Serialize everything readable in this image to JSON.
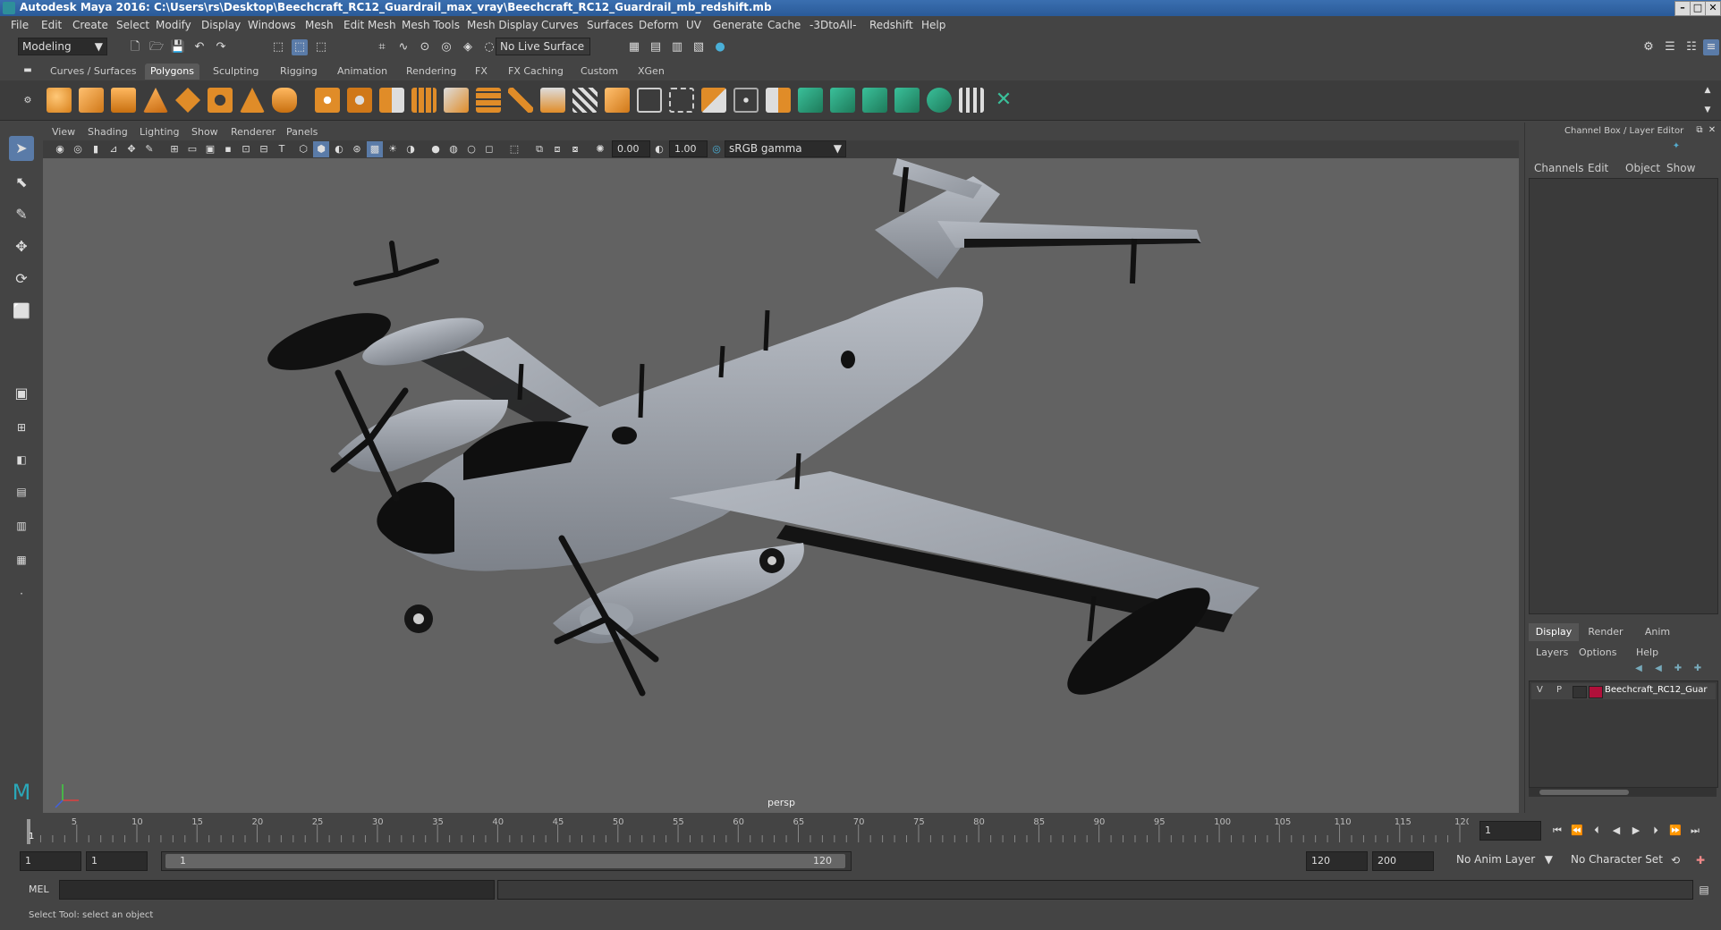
{
  "window": {
    "title": "Autodesk Maya 2016: C:\\Users\\rs\\Desktop\\Beechcraft_RC12_Guardrail_max_vray\\Beechcraft_RC12_Guardrail_mb_redshift.mb",
    "min": "–",
    "max": "□",
    "close": "✕"
  },
  "menubar": [
    "File",
    "Edit",
    "Create",
    "Select",
    "Modify",
    "Display",
    "Windows",
    "Mesh",
    "Edit Mesh",
    "Mesh Tools",
    "Mesh Display",
    "Curves",
    "Surfaces",
    "Deform",
    "UV",
    "Generate",
    "Cache",
    "-3DtoAll-",
    "Redshift",
    "Help"
  ],
  "statusline": {
    "mode": "Modeling",
    "live_surface": "No Live Surface"
  },
  "shelf_tabs": [
    "Curves / Surfaces",
    "Polygons",
    "Sculpting",
    "Rigging",
    "Animation",
    "Rendering",
    "FX",
    "FX Caching",
    "Custom",
    "XGen"
  ],
  "viewport": {
    "menu": [
      "View",
      "Shading",
      "Lighting",
      "Show",
      "Renderer",
      "Panels"
    ],
    "field1": "0.00",
    "field2": "1.00",
    "color_space": "sRGB gamma",
    "camera_label": "persp"
  },
  "channel_box": {
    "title": "Channel Box / Layer Editor",
    "menu": [
      "Channels",
      "Edit",
      "Object",
      "Show"
    ]
  },
  "layer_editor": {
    "tabs": [
      "Display",
      "Render",
      "Anim"
    ],
    "menu": [
      "Layers",
      "Options",
      "Help"
    ],
    "layer": {
      "v": "V",
      "p": "P",
      "name": "Beechcraft_RC12_Guar",
      "color": "#b0103a"
    }
  },
  "timeline": {
    "ticks": [
      "5",
      "10",
      "15",
      "20",
      "25",
      "30",
      "35",
      "40",
      "45",
      "50",
      "55",
      "60",
      "65",
      "70",
      "75",
      "80",
      "85",
      "90",
      "95",
      "100",
      "105",
      "110",
      "115",
      "120"
    ],
    "start_label": "1",
    "current_frame": "1"
  },
  "range": {
    "start": "1",
    "playback_start": "1",
    "slider_start": "1",
    "slider_end": "120",
    "playback_end": "120",
    "end": "200",
    "anim_layer": "No Anim Layer",
    "char_set": "No Character Set"
  },
  "cmdline": {
    "label": "MEL"
  },
  "helpline": {
    "text": "Select Tool: select an object"
  },
  "colors": {
    "accent": "#4a90c8",
    "panel": "#444444",
    "viewport": "#626262",
    "title": "#2a5a98"
  }
}
